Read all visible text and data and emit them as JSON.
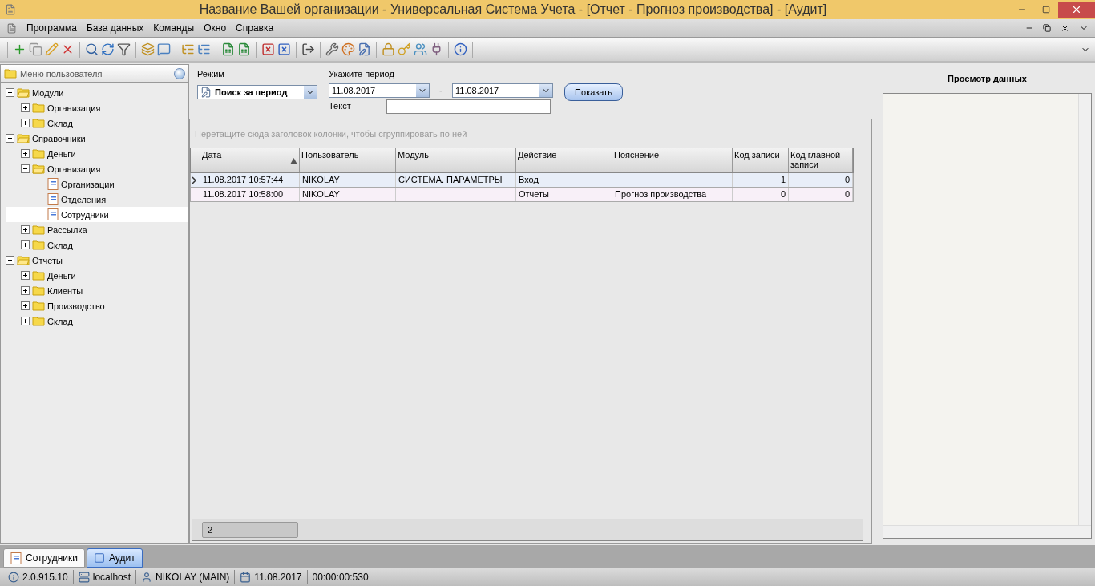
{
  "window": {
    "title": "Название Вашей организации - Универсальная Система Учета - [Отчет - Прогноз производства] - [Аудит]"
  },
  "menu": [
    "Программа",
    "База данных",
    "Команды",
    "Окно",
    "Справка"
  ],
  "sidebar": {
    "title": "Меню пользователя",
    "tree": [
      {
        "label": "Модули",
        "kind": "folder",
        "expanded": true,
        "selected": false,
        "children": [
          {
            "label": "Организация",
            "kind": "folder",
            "expanded": false,
            "selected": false
          },
          {
            "label": "Склад",
            "kind": "folder",
            "expanded": false,
            "selected": false
          }
        ]
      },
      {
        "label": "Справочники",
        "kind": "folder",
        "expanded": true,
        "selected": false,
        "children": [
          {
            "label": "Деньги",
            "kind": "folder",
            "expanded": false,
            "selected": false
          },
          {
            "label": "Организация",
            "kind": "folder",
            "expanded": true,
            "selected": false,
            "children": [
              {
                "label": "Организации",
                "kind": "doc",
                "selected": false
              },
              {
                "label": "Отделения",
                "kind": "doc",
                "selected": false
              },
              {
                "label": "Сотрудники",
                "kind": "doc",
                "selected": true
              }
            ]
          },
          {
            "label": "Рассылка",
            "kind": "folder",
            "expanded": false,
            "selected": false
          },
          {
            "label": "Склад",
            "kind": "folder",
            "expanded": false,
            "selected": false
          }
        ]
      },
      {
        "label": "Отчеты",
        "kind": "folder",
        "expanded": true,
        "selected": false,
        "children": [
          {
            "label": "Деньги",
            "kind": "folder",
            "expanded": false,
            "selected": false
          },
          {
            "label": "Клиенты",
            "kind": "folder",
            "expanded": false,
            "selected": false
          },
          {
            "label": "Производство",
            "kind": "folder",
            "expanded": false,
            "selected": false
          },
          {
            "label": "Склад",
            "kind": "folder",
            "expanded": false,
            "selected": false
          }
        ]
      }
    ]
  },
  "filters": {
    "mode_label": "Режим",
    "mode_value": "Поиск за период",
    "period_label": "Укажите период",
    "date_from": "11.08.2017",
    "separator": "-",
    "date_to": "11.08.2017",
    "text_label": "Текст",
    "show_button": "Показать"
  },
  "grid": {
    "group_hint": "Перетащите сюда заголовок колонки, чтобы сгруппировать по ней",
    "columns": [
      {
        "label": "Дата",
        "sorted": true
      },
      {
        "label": "Пользователь",
        "sorted": false
      },
      {
        "label": "Модуль",
        "sorted": false
      },
      {
        "label": "Действие",
        "sorted": false
      },
      {
        "label": "Пояснение",
        "sorted": false
      },
      {
        "label": "Код записи",
        "sorted": false
      },
      {
        "label": "Код главной записи",
        "sorted": false
      }
    ],
    "rows": [
      {
        "selected": true,
        "cells": [
          "11.08.2017 10:57:44",
          "NIKOLAY",
          "СИСТЕМА. ПАРАМЕТРЫ",
          "Вход",
          "",
          "1",
          "0"
        ]
      },
      {
        "selected": false,
        "cells": [
          "11.08.2017 10:58:00",
          "NIKOLAY",
          "",
          "Отчеты",
          "Прогноз производства",
          "0",
          "0"
        ]
      }
    ],
    "count": "2"
  },
  "preview": {
    "title": "Просмотр данных"
  },
  "tabs": [
    {
      "label": "Сотрудники",
      "selected": false
    },
    {
      "label": "Аудит",
      "selected": true
    }
  ],
  "status_bar": [
    {
      "kind": "version",
      "text": "2.0.915.10"
    },
    {
      "kind": "server",
      "text": "localhost"
    },
    {
      "kind": "user",
      "text": "NIKOLAY (MAIN)"
    },
    {
      "kind": "date",
      "text": "11.08.2017"
    },
    {
      "kind": "time",
      "text": "00:00:00:530"
    }
  ]
}
